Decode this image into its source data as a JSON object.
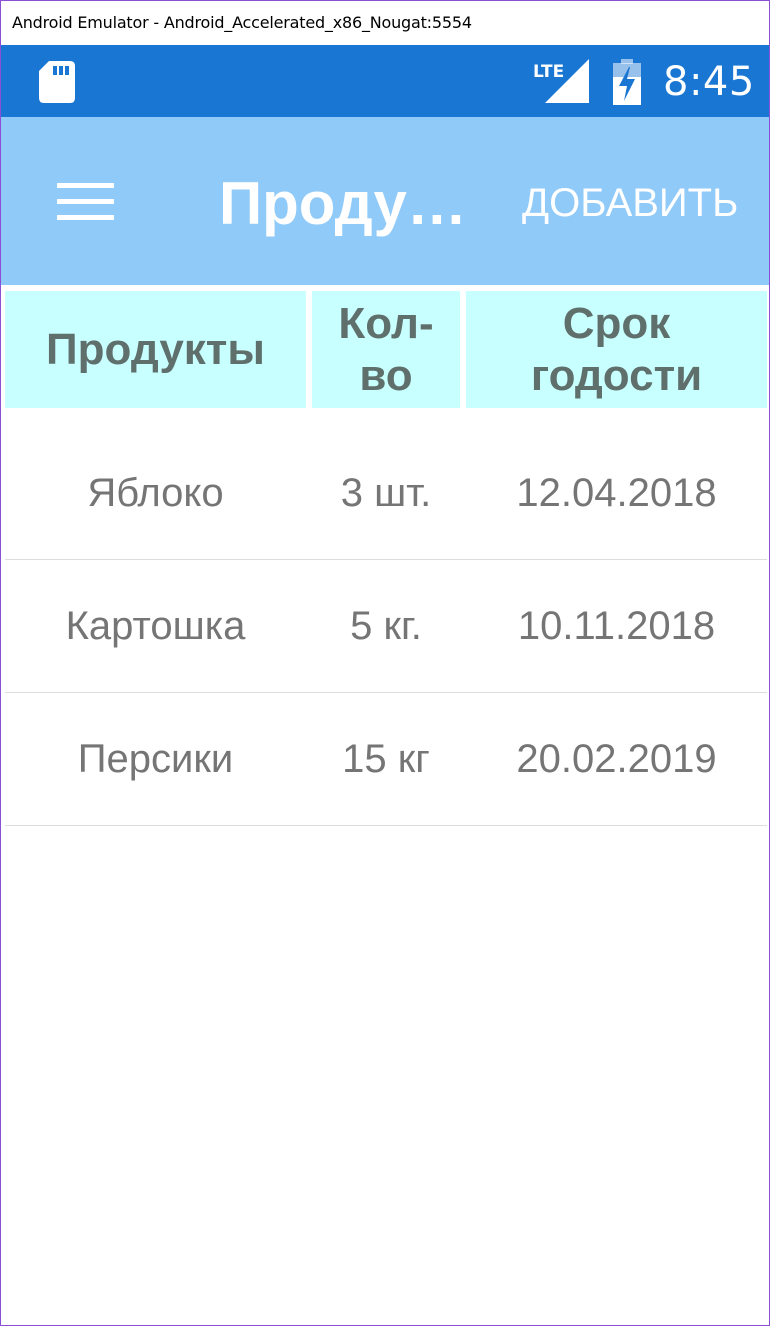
{
  "window": {
    "title": "Android Emulator - Android_Accelerated_x86_Nougat:5554"
  },
  "status_bar": {
    "time": "8:45",
    "network": "LTE",
    "icons": [
      "sd-card-icon",
      "lte-signal-icon",
      "battery-charging-icon"
    ],
    "color": "#1976d2"
  },
  "toolbar": {
    "title": "Продукты",
    "add_label": "ДОБАВИТЬ",
    "menu_icon": "hamburger-menu-icon",
    "color": "#90caf9"
  },
  "table": {
    "header_color": "#c8ffff",
    "headers": {
      "name": "Продукты",
      "qty_line1": "Кол-",
      "qty_line2": "во",
      "expiry_line1": "Срок",
      "expiry_line2": "годости"
    },
    "rows": [
      {
        "name": "Яблоко",
        "qty": "3 шт.",
        "expiry": "12.04.2018"
      },
      {
        "name": "Картошка",
        "qty": "5 кг.",
        "expiry": "10.11.2018"
      },
      {
        "name": "Персики",
        "qty": "15 кг",
        "expiry": "20.02.2019"
      }
    ]
  }
}
